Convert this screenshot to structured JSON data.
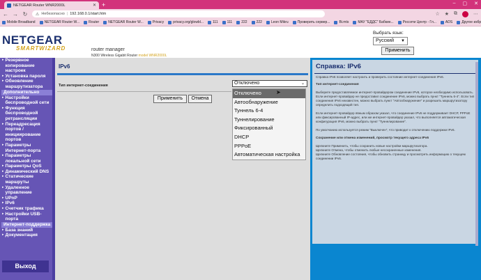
{
  "browser": {
    "tabs": [
      {
        "title": "NETGEAR Router WNR2000L"
      }
    ],
    "window_controls": [
      "–",
      "▢",
      "✕"
    ],
    "address": {
      "insecure_label": "Небезопасно",
      "url": "192.168.0.1/start.htm"
    },
    "bookmarks": [
      "Mobile Broadband",
      "NETGEAR Router W...",
      "Router",
      "NETGEAR Router W...",
      "Privacy",
      "privacy.org/glowbl...",
      "111",
      "111",
      "222",
      "222",
      "Leon Mikru",
      "Проверить сервер...",
      "Bi.mts",
      "МАУ \"ЕДДС\" Бабкин...",
      "Россети Центр - Гл...",
      "ADS",
      "Другое избранное"
    ]
  },
  "header": {
    "logo_main": "NETGEAR",
    "logo_sub": "SMARTWIZARD",
    "router_manager": "router manager",
    "model_line": "N300 Wireless Gigabit Router",
    "model_label": "model WNR2000L",
    "lang_label": "Выбрать язык:",
    "lang_value": "Русский",
    "lang_apply": "Применить"
  },
  "sidebar": {
    "items": [
      {
        "label": "Резервное копирование настроек"
      },
      {
        "label": "Установка пароля"
      },
      {
        "label": "Обновление маршрутизатора"
      },
      {
        "header": "Дополнительно"
      },
      {
        "label": "Настройки беспроводной сети"
      },
      {
        "label": "Функция беспроводной ретрансляции"
      },
      {
        "label": "Переадресация портов / инициирование портов"
      },
      {
        "label": "Параметры Интернет-порта"
      },
      {
        "label": "Параметры локальной сети"
      },
      {
        "label": "Параметры QoS"
      },
      {
        "label": "Динамический DNS"
      },
      {
        "label": "Статические маршруты"
      },
      {
        "label": "Удаленное управление"
      },
      {
        "label": "UPnP"
      },
      {
        "label": "IPv6"
      },
      {
        "label": "Счетчик трафика"
      },
      {
        "label": "Настройки USB-порта"
      },
      {
        "header": "Интернет-поддержка"
      },
      {
        "label": "База знаний"
      },
      {
        "label": "Документация"
      }
    ],
    "exit_label": "Выход"
  },
  "content": {
    "title": "IPv6",
    "connection_label": "Тип интернет-соединения",
    "connection_value": "Отключено",
    "apply_label": "Применить",
    "cancel_label": "Отмена",
    "dropdown_options": [
      "Отключено",
      "Автообнаружение",
      "Туннель 6-4",
      "Туннелирование",
      "Фиксированный",
      "DHCP",
      "PPPoE",
      "Автоматическая настройка"
    ],
    "selected_index": 0
  },
  "help": {
    "title": "Справка: IPv6",
    "intro": "Справка IPv6 позволяет настроить и проверить состояние интернет-соединения IPv6.",
    "section1": "Тип интернет-соединения",
    "para1": "Выберите предоставляемое интернет-провайдером соединение IPv6, которое необходимо использовать. Если интернет-провайдер не предоставил соединение IPv6, можно выбрать пункт \"Туннель 6-4\". Если тип соединения IPv6 неизвестен, можно выбрать пункт \"Автообнаружение\" и разрешить маршрутизатору определить подходящий тип.",
    "para2": "Если интернет-провайдер явным образом указал, что соединение IPv6 не поддерживает DHCP, PPPoE или фиксированный IP-адрес, или же интернет-провайдер указал, что выполняется автоматическая конфигурация IPv6, можно выбрать пункт \"Туннелирование\".",
    "para3": "По умолчанию используется режим \"Выключен\", что приводит к отключению поддержки IPv6.",
    "section2": "Сохранение или отмена изменений, просмотр текущего адреса IPv6",
    "para4": "Щелкните Применить, чтобы сохранить новые настройки маршрутизатора.",
    "para5": "Щелкните Отмена, чтобы отменить любые несохраненные изменения.",
    "para6": "Щелкните Обновление состояния, чтобы обновить страницу и просмотреть информацию о текущем соединении IPv6."
  },
  "colors": {
    "tabstrip": "#d2337b",
    "sidebar": "#6655b5",
    "help_bg": "#0a86d0",
    "title_navy": "#1a2f6e",
    "brand_gold": "#d3a21b"
  }
}
